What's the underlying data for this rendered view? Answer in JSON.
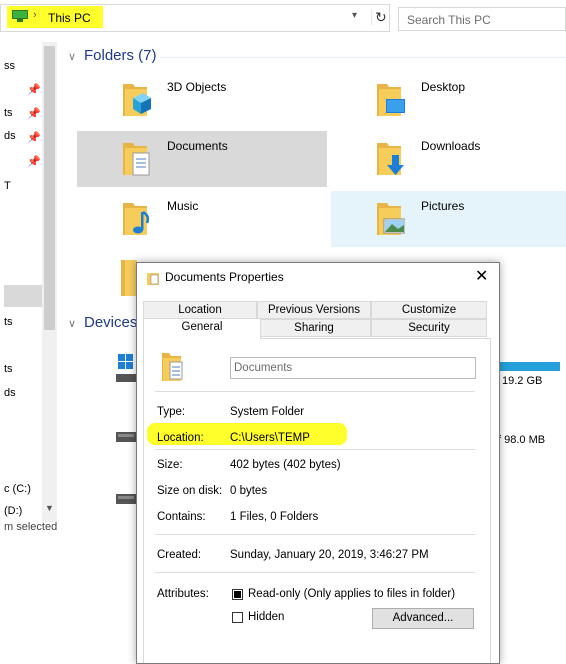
{
  "address": {
    "crumb": "This PC",
    "search_placeholder": "Search This PC"
  },
  "nav": {
    "items": [
      "ss",
      "ts",
      "ds",
      "ds",
      "T",
      "ts",
      "ts",
      "ds",
      "c (C:)",
      "(D:)"
    ],
    "status": "m selected"
  },
  "folders_section": {
    "title": "Folders (7)"
  },
  "folders": [
    {
      "label": "3D Objects"
    },
    {
      "label": "Desktop"
    },
    {
      "label": "Documents"
    },
    {
      "label": "Downloads"
    },
    {
      "label": "Music"
    },
    {
      "label": "Pictures"
    }
  ],
  "devices_section": {
    "title": "Devices"
  },
  "drives": [
    {
      "free": "19.2 GB"
    },
    {
      "free": "f 98.0 MB"
    }
  ],
  "dialog": {
    "title": "Documents Properties",
    "tabs_top": [
      "Location",
      "Previous Versions",
      "Customize"
    ],
    "tabs_bottom": [
      "General",
      "Sharing",
      "Security"
    ],
    "name_value": "Documents",
    "rows": {
      "type_label": "Type:",
      "type_value": "System Folder",
      "location_label": "Location:",
      "location_value": "C:\\Users\\TEMP",
      "size_label": "Size:",
      "size_value": "402 bytes (402 bytes)",
      "size_on_disk_label": "Size on disk:",
      "size_on_disk_value": "0 bytes",
      "contains_label": "Contains:",
      "contains_value": "1 Files, 0 Folders",
      "created_label": "Created:",
      "created_value": "Sunday, January 20, 2019, 3:46:27 PM",
      "attributes_label": "Attributes:"
    },
    "attributes": {
      "readonly_label": "Read-only (Only applies to files in folder)",
      "readonly_checked": true,
      "hidden_label": "Hidden",
      "hidden_checked": false,
      "advanced_button": "Advanced..."
    }
  },
  "colors": {
    "highlight": "#ffff2b",
    "accent": "#1e3a8a",
    "folder": "#f6cc5b"
  }
}
